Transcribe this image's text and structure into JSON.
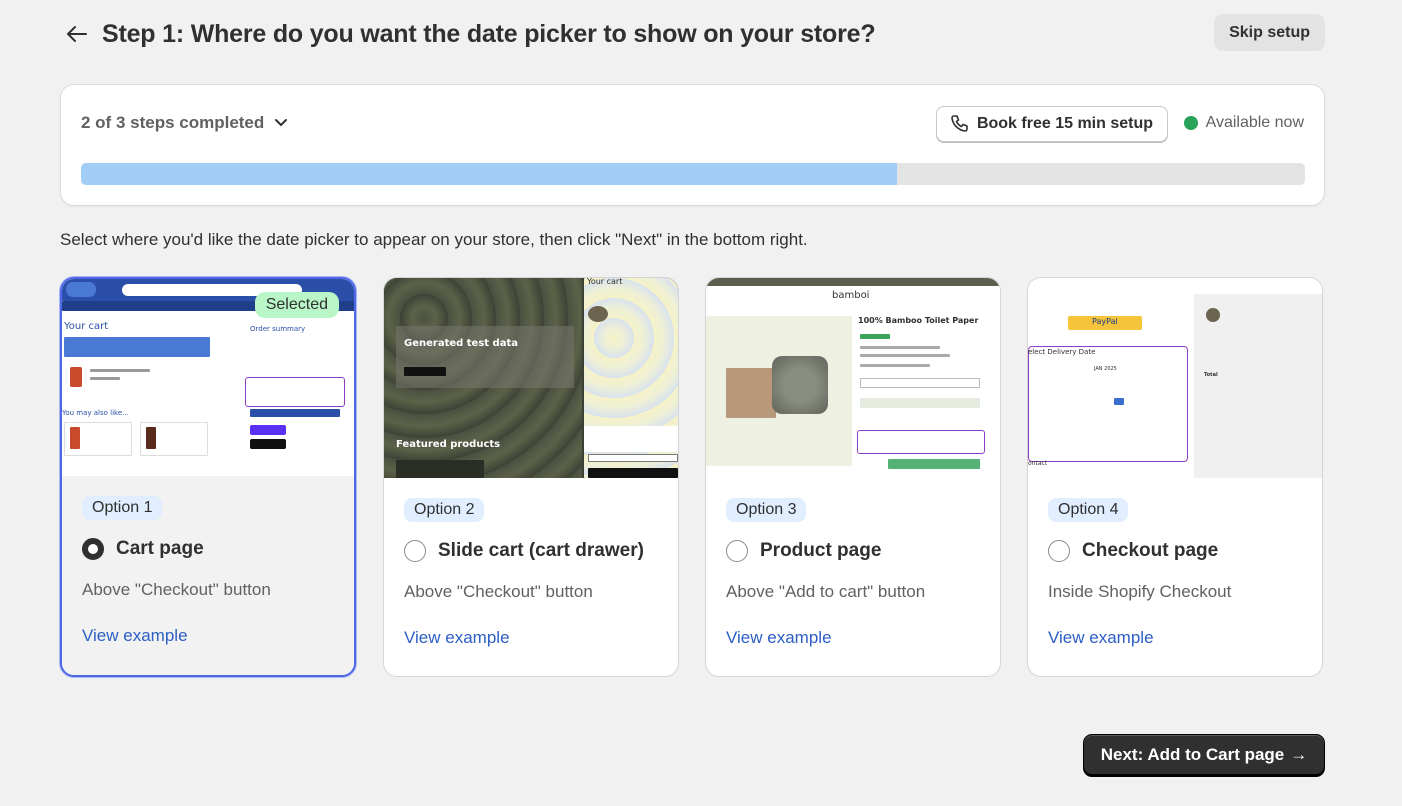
{
  "header": {
    "title": "Step 1: Where do you want the date picker to show on your store?",
    "skip_label": "Skip setup"
  },
  "progress": {
    "steps_label": "2 of 3 steps completed",
    "book_label": "Book free 15 min setup",
    "availability_label": "Available now",
    "fraction": 0.667,
    "fill_color": "#a1cdf7",
    "status_color": "#29a35a"
  },
  "instructions": "Select where you'd like the date picker to appear on your store, then click \"Next\" in the bottom right.",
  "options": [
    {
      "badge": "Option 1",
      "title": "Cart page",
      "desc": "Above \"Checkout\" button",
      "link": "View example",
      "selected": true,
      "selected_label": "Selected"
    },
    {
      "badge": "Option 2",
      "title": "Slide cart (cart drawer)",
      "desc": "Above \"Checkout\" button",
      "link": "View example",
      "selected": false
    },
    {
      "badge": "Option 3",
      "title": "Product page",
      "desc": "Above \"Add to cart\" button",
      "link": "View example",
      "selected": false
    },
    {
      "badge": "Option 4",
      "title": "Checkout page",
      "desc": "Inside Shopify Checkout",
      "link": "View example",
      "selected": false
    }
  ],
  "thumbnails": {
    "cart": {
      "heading": "Your cart",
      "side": "Order summary",
      "also": "You may also like..."
    },
    "slide": {
      "hero": "Generated test data",
      "featured": "Featured products",
      "cart": "Your cart"
    },
    "product": {
      "brand": "bamboi",
      "title": "100% Bamboo Toilet Paper"
    },
    "checkout": {
      "paypal": "PayPal",
      "delivery": "elect Delivery Date",
      "month": "JAN 2025",
      "total": "Total",
      "contact": "ontact"
    }
  },
  "next_button": {
    "label": "Next: Add to Cart page",
    "arrow": "→"
  },
  "icons": [
    "back-arrow-icon",
    "chevron-down-icon",
    "phone-icon",
    "radio-icon"
  ]
}
